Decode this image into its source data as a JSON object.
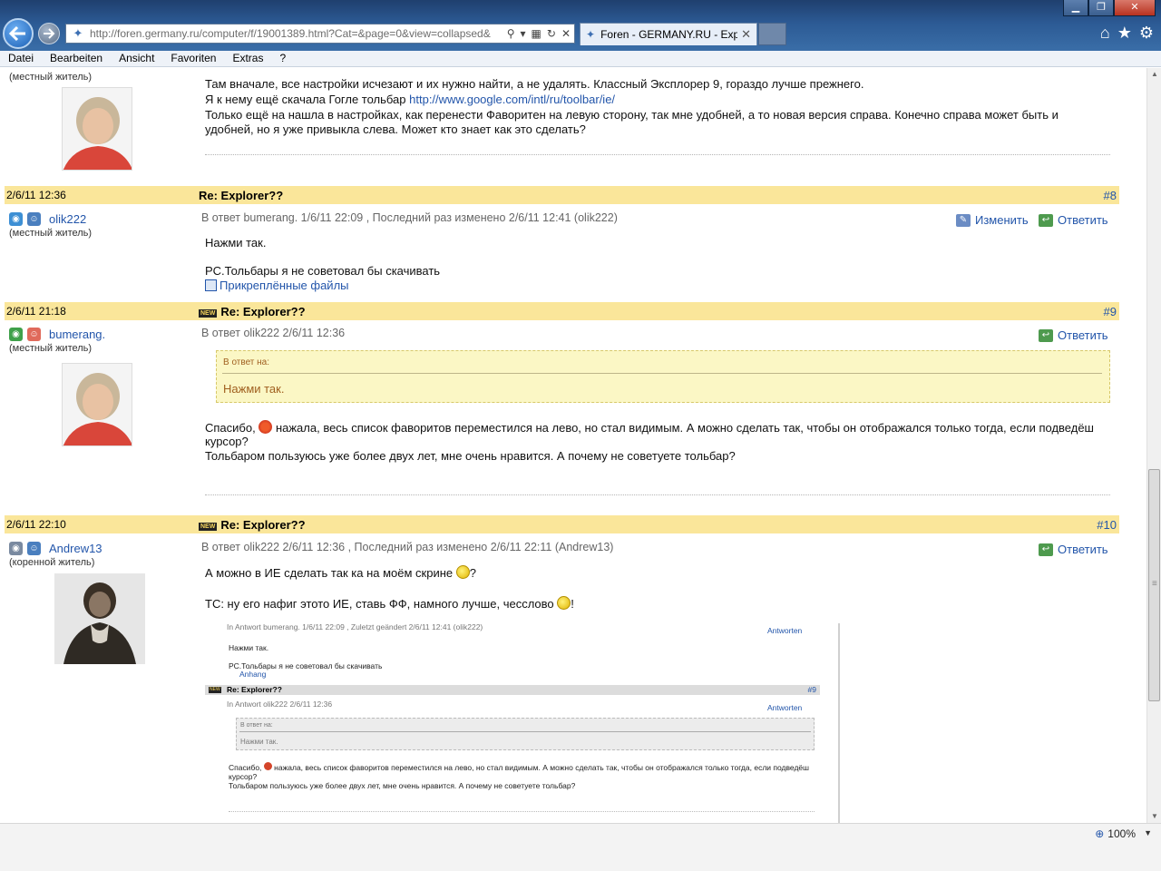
{
  "browser": {
    "url": "http://foren.germany.ru/computer/f/19001389.html?Cat=&page=0&view=collapsed&",
    "tab_title": "Foren - GERMANY.RU - Exp...",
    "tab_close": "✕",
    "window_controls": [
      "▁",
      "❐",
      "✕"
    ],
    "icons": [
      "home-icon",
      "favorites-star-icon",
      "tools-gear-icon"
    ]
  },
  "menu": [
    "Datei",
    "Bearbeiten",
    "Ansicht",
    "Favoriten",
    "Extras",
    "?"
  ],
  "post7": {
    "rank": "(местный житель)",
    "line1": "Там вначале, все настройки исчезают и их нужно найти, а не удалять. Классный Эксплорер 9, гораздо лучше прежнего.",
    "line2_prefix": "Я к нему ещё скачала Гогле тольбар ",
    "line2_link": "http://www.google.com/intl/ru/toolbar/ie/",
    "line3": "Только ещё на нашла в настройках, как перенести Фаворитен на левую сторону, так мне удобней, а то новая версия справа. Конечно справа может быть и",
    "line4": "удобней, но я уже привыкла слева. Может кто знает как это сделать?"
  },
  "post8": {
    "date": "2/6/11 12:36",
    "title": "Re: Explorer??",
    "number": "#8",
    "user": "olik222",
    "rank": "(местный житель)",
    "meta": "В ответ bumerang. 1/6/11 22:09 , Последний раз изменено 2/6/11 12:41 (olik222)",
    "edit_label": "Изменить",
    "reply_label": "Ответить",
    "line1": "Нажми так.",
    "line2": "PC.Тольбары я не советовал бы скачивать",
    "attachments": "Прикреплённые файлы"
  },
  "post9": {
    "date": "2/6/11 21:18",
    "badge": "NEW",
    "title": "Re: Explorer??",
    "number": "#9",
    "user": "bumerang.",
    "rank": "(местный житель)",
    "meta": "В ответ olik222 2/6/11 12:36",
    "reply_label": "Ответить",
    "quote_label": "В ответ на:",
    "quote_text": "Нажми так.",
    "line1_a": "Спасибо, ",
    "line1_b": " нажала, весь список фаворитов переместился на лево, но стал видимым. А можно сделать так, чтобы он отображался только тогда, если подведёш",
    "line2": "курсор?",
    "line3": "Тольбаром пользуюсь уже более двух лет, мне очень нравится. А почему не советуете тольбар?"
  },
  "post10": {
    "date": "2/6/11 22:10",
    "badge": "NEW",
    "title": "Re: Explorer??",
    "number": "#10",
    "user": "Andrew13",
    "rank": "(коренной житель)",
    "meta": "В ответ olik222 2/6/11 12:36 , Последний раз изменено 2/6/11 22:11 (Andrew13)",
    "reply_label": "Ответить",
    "line1_a": "А можно в ИЕ сделать так ка на моём скрине ",
    "line1_b": "?",
    "line2_a": "ТС: ну его нафиг этото ИЕ, ставь ФФ, намного лучше, чесслово ",
    "line2_b": "!"
  },
  "embedded": {
    "meta1": "In Antwort bumerang. 1/6/11 22:09 , Zuletzt geändert 2/6/11 12:41 (olik222)",
    "reply1": "Antworten",
    "text1": "Нажми так.",
    "text2": "PC.Тольбары я не советовал бы скачивать",
    "attach": "Anhang",
    "badge": "NEW",
    "title": "Re: Explorer??",
    "number": "#9",
    "meta2": "In Antwort olik222 2/6/11 12:36",
    "reply2": "Antworten",
    "quote_label": "В ответ на:",
    "quote_text": "Нажми так.",
    "line1_a": "Спасибо, ",
    "line1_b": " нажала, весь список фаворитов переместился на лево, но стал видимым. А можно сделать так, чтобы он отображался только тогда, если подведёш",
    "line2": "курсор?",
    "line3": "Тольбаром пользуюсь уже более двух лет, мне очень нравится. А почему не советуете тольбар?"
  },
  "status": {
    "zoom": "100%"
  },
  "colors": {
    "post_header": "#fae69a",
    "link": "#2255aa",
    "quote_bg": "#fbf7c5"
  }
}
